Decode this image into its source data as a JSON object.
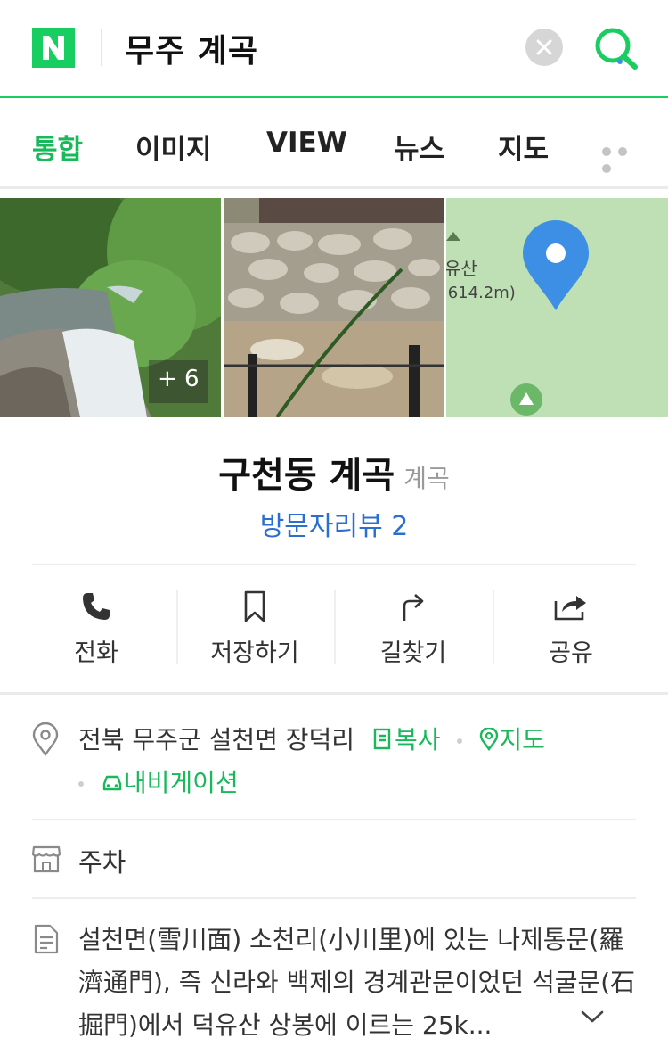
{
  "search": {
    "query": "무주 계곡"
  },
  "tabs": [
    {
      "label": "통합"
    },
    {
      "label": "이미지"
    },
    {
      "label": "VIEW"
    },
    {
      "label": "뉴스"
    },
    {
      "label": "지도"
    }
  ],
  "photos": {
    "more_count": "+ 6",
    "map_label_name": "유산",
    "map_label_height": ",614.2m)"
  },
  "place": {
    "name": "구천동 계곡",
    "category": "계곡",
    "review": "방문자리뷰 2"
  },
  "actions": [
    {
      "label": "전화"
    },
    {
      "label": "저장하기"
    },
    {
      "label": "길찾기"
    },
    {
      "label": "공유"
    }
  ],
  "info": {
    "address": "전북 무주군 설천면 장덕리",
    "copy_label": "복사",
    "map_label": "지도",
    "navigation_label": "내비게이션",
    "parking": "주차",
    "description": "설천면(雪川面) 소천리(小川里)에 있는 나제통문(羅濟通門), 즉 신라와 백제의 경계관문이었던 석굴문(石掘門)에서 덕유산 상봉에 이르는 25k..."
  },
  "colors": {
    "naver_green": "#19ce60",
    "link_green": "#19b85a",
    "link_blue": "#2a6fcf",
    "pin_blue": "#3d8fe6"
  }
}
